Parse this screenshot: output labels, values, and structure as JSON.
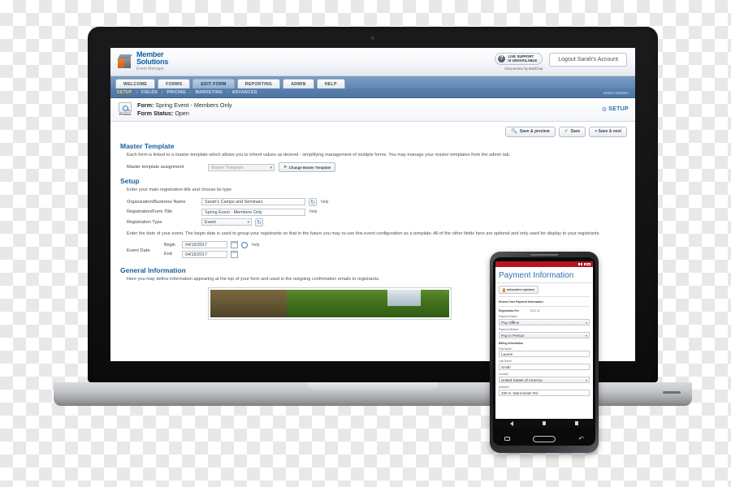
{
  "app": {
    "logo": {
      "line1": "Member",
      "line2": "Solutions",
      "line3": "Event Manager"
    },
    "live_support": {
      "line1": "LIVE SUPPORT",
      "line2": "IS UNAVAILABLE",
      "icon": "question-mark-icon"
    },
    "chat_credit": "Chat service by BoldChat",
    "logout_label": "Logout Sarah's Account",
    "version": "version 201605A"
  },
  "tabs": [
    {
      "label": "WELCOME",
      "active": false
    },
    {
      "label": "FORMS",
      "active": false
    },
    {
      "label": "EDIT FORM",
      "active": true
    },
    {
      "label": "REPORTING",
      "active": false
    },
    {
      "label": "ADMIN",
      "active": false
    },
    {
      "label": "HELP",
      "active": false
    }
  ],
  "subnav": [
    {
      "label": "SETUP",
      "active": true
    },
    {
      "label": "FIELDS",
      "active": false
    },
    {
      "label": "PRICING",
      "active": false
    },
    {
      "label": "MARKETING",
      "active": false
    },
    {
      "label": "ADVANCED",
      "active": false
    }
  ],
  "form_header": {
    "preview_label": "Preview",
    "form_line": "Form: Spring Event - Members Only",
    "form_label": "Form:",
    "form_value": "Spring Event - Members Only",
    "status_label": "Form Status:",
    "status_value": "Open",
    "setup_badge": "SETUP"
  },
  "toolbar": {
    "save_preview_label": "Save & preview",
    "save_label": "Save",
    "save_next_label": "Save & next"
  },
  "master_template": {
    "heading": "Master Template",
    "description": "Each form is linked to a master template which allows you to inherit values as desired - simplifying management of multiple forms. You may manage your master templates from the admin tab.",
    "assignment_label": "Master template assignment",
    "select_value": "Master Template",
    "change_button": "Change Master Template"
  },
  "setup": {
    "heading": "Setup",
    "description": "Enter your main registration title and choose its type:",
    "fields": [
      {
        "label": "Organization/Business Name",
        "value": "Sarah's Camps and Seminars",
        "help": "help"
      },
      {
        "label": "Registration/Form Title",
        "value": "Spring Event - Members Only",
        "help": "help"
      },
      {
        "label": "Registration Type",
        "value": "Event",
        "help": ""
      }
    ],
    "date_description": "Enter the date of your event. The begin date is used to group your registrants so that in the future you may re-use this event configuration as a template. All of the other fields here are optional and only used for display to your registrants.",
    "date_label": "Event Date",
    "begin_label": "Begin",
    "begin_value": "04/15/2017",
    "end_label": "End",
    "end_value": "04/15/2017",
    "date_help": "help"
  },
  "general_information": {
    "heading": "General Information",
    "description": "Here you may define information appearing at the top of your form and used in the outgoing confirmation emails to registrants."
  },
  "phone": {
    "status_time": "",
    "title": "Payment Information",
    "add_registrant": "add another registrant",
    "review_heading": "Review Your Payment Information",
    "fee_label": "Registration Fee",
    "fee_amount": "$100.00",
    "payment_option_label": "Payment Option",
    "payment_option_value": "Pay Offline",
    "payment_method_label": "Payment Method",
    "payment_method_value": "Pay in Person",
    "billing_heading": "Billing Information",
    "first_name_label": "First Name",
    "first_name_value": "Lauren",
    "last_name_label": "Last Name",
    "last_name_value": "Smith",
    "country_label": "Country",
    "country_value": "United States of America",
    "address_label": "Address",
    "address_value": "330 S. Warminster Rd",
    "required_mark": "*"
  }
}
